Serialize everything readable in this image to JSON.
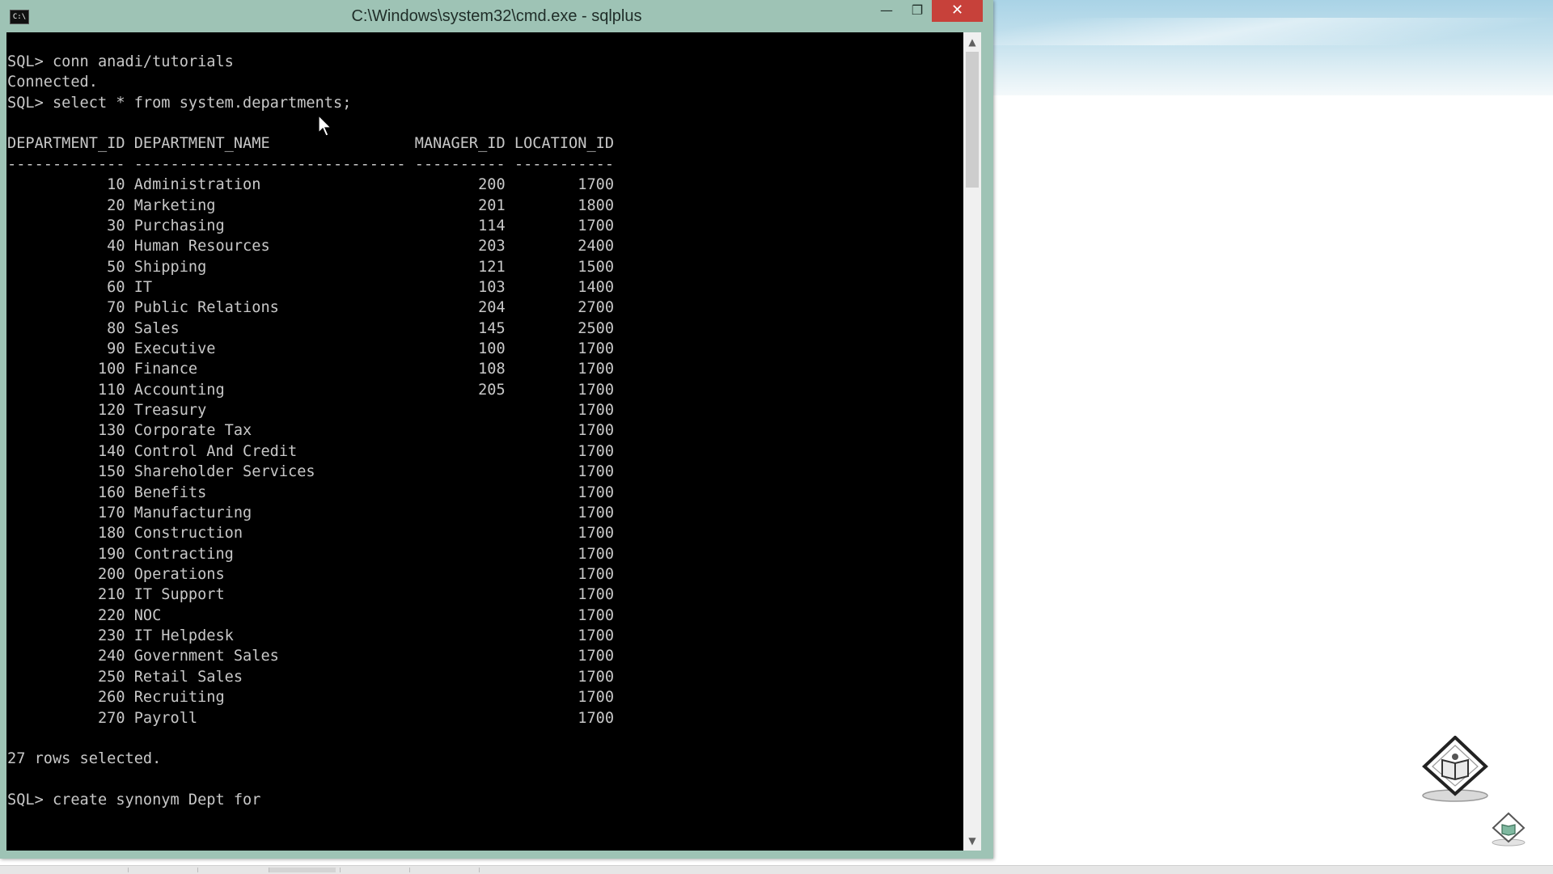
{
  "window": {
    "title": "C:\\Windows\\system32\\cmd.exe - sqlplus",
    "app_icon_text": "C:\\",
    "minimize_glyph": "—",
    "maximize_glyph": "❐",
    "close_glyph": "✕"
  },
  "console": {
    "lines": [
      "SQL> conn anadi/tutorials",
      "Connected.",
      "SQL> select * from system.departments;",
      "",
      "DEPARTMENT_ID DEPARTMENT_NAME                MANAGER_ID LOCATION_ID",
      "------------- ------------------------------ ---------- -----------",
      "           10 Administration                        200        1700",
      "           20 Marketing                             201        1800",
      "           30 Purchasing                            114        1700",
      "           40 Human Resources                       203        2400",
      "           50 Shipping                              121        1500",
      "           60 IT                                    103        1400",
      "           70 Public Relations                      204        2700",
      "           80 Sales                                 145        2500",
      "           90 Executive                             100        1700",
      "          100 Finance                               108        1700",
      "          110 Accounting                            205        1700",
      "          120 Treasury                                         1700",
      "          130 Corporate Tax                                    1700",
      "          140 Control And Credit                               1700",
      "          150 Shareholder Services                             1700",
      "          160 Benefits                                         1700",
      "          170 Manufacturing                                    1700",
      "          180 Construction                                     1700",
      "          190 Contracting                                      1700",
      "          200 Operations                                       1700",
      "          210 IT Support                                       1700",
      "          220 NOC                                              1700",
      "          230 IT Helpdesk                                      1700",
      "          240 Government Sales                                 1700",
      "          250 Retail Sales                                     1700",
      "          260 Recruiting                                       1700",
      "          270 Payroll                                          1700",
      "",
      "27 rows selected.",
      "",
      "SQL> create synonym Dept for"
    ]
  },
  "scrollbar": {
    "up_glyph": "▲",
    "down_glyph": "▼"
  },
  "colors": {
    "frame": "#9ec3b5",
    "console_bg": "#000000",
    "console_fg": "#c8c8c8",
    "close_button": "#c7413a"
  },
  "icons": [
    "console-app-icon",
    "minimize-icon",
    "maximize-icon",
    "close-icon",
    "mouse-pointer-icon",
    "tutorials-logo-icon"
  ]
}
